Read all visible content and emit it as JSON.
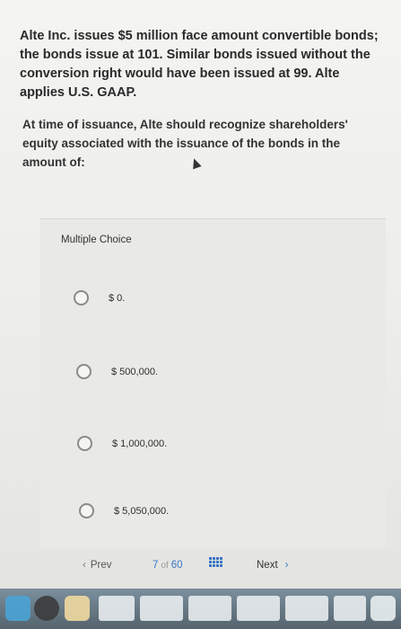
{
  "question": {
    "text": "Alte Inc. issues $5 million face amount convertible bonds; the bonds issue at 101. Similar bonds issued without the conversion right would have been issued at 99. Alte applies U.S. GAAP."
  },
  "prompt": {
    "text": "At time of issuance, Alte should recognize shareholders' equity associated with the issuance of the bonds in the amount of:"
  },
  "multiple_choice": {
    "title": "Multiple Choice",
    "options": [
      {
        "label": "$ 0."
      },
      {
        "label": "$ 500,000."
      },
      {
        "label": "$ 1,000,000."
      },
      {
        "label": "$ 5,050,000."
      }
    ]
  },
  "navigation": {
    "prev_label": "Prev",
    "current_page": "7",
    "of_label": "of",
    "total_pages": "60",
    "next_label": "Next",
    "prev_icon": "chevron-left-icon",
    "next_icon": "chevron-right-icon",
    "grid_icon": "question-grid-icon",
    "accent_color": "#3a76c4"
  }
}
